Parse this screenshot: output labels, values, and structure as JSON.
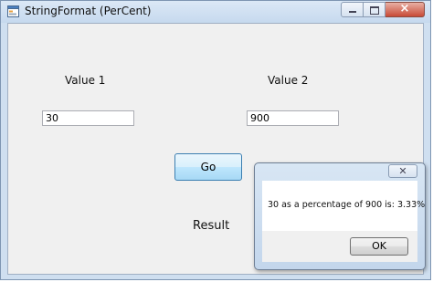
{
  "window": {
    "title": "StringFormat (PerCent)",
    "icon": "form-icon"
  },
  "caption_buttons": {
    "close_glyph": "×"
  },
  "form": {
    "value1_label": "Value 1",
    "value2_label": "Value 2",
    "value1_input": "30",
    "value2_input": "900",
    "go_button": "Go",
    "result_label": "Result"
  },
  "message_box": {
    "close_glyph": "✕",
    "message": "30 as a percentage of 900 is: 3.33%",
    "ok_button": "OK"
  },
  "colors": {
    "client_background": "#f0f0f0",
    "title_bar": "#c6d9ee",
    "close_button": "#c84a36",
    "go_button_border": "#3c7fb1"
  }
}
